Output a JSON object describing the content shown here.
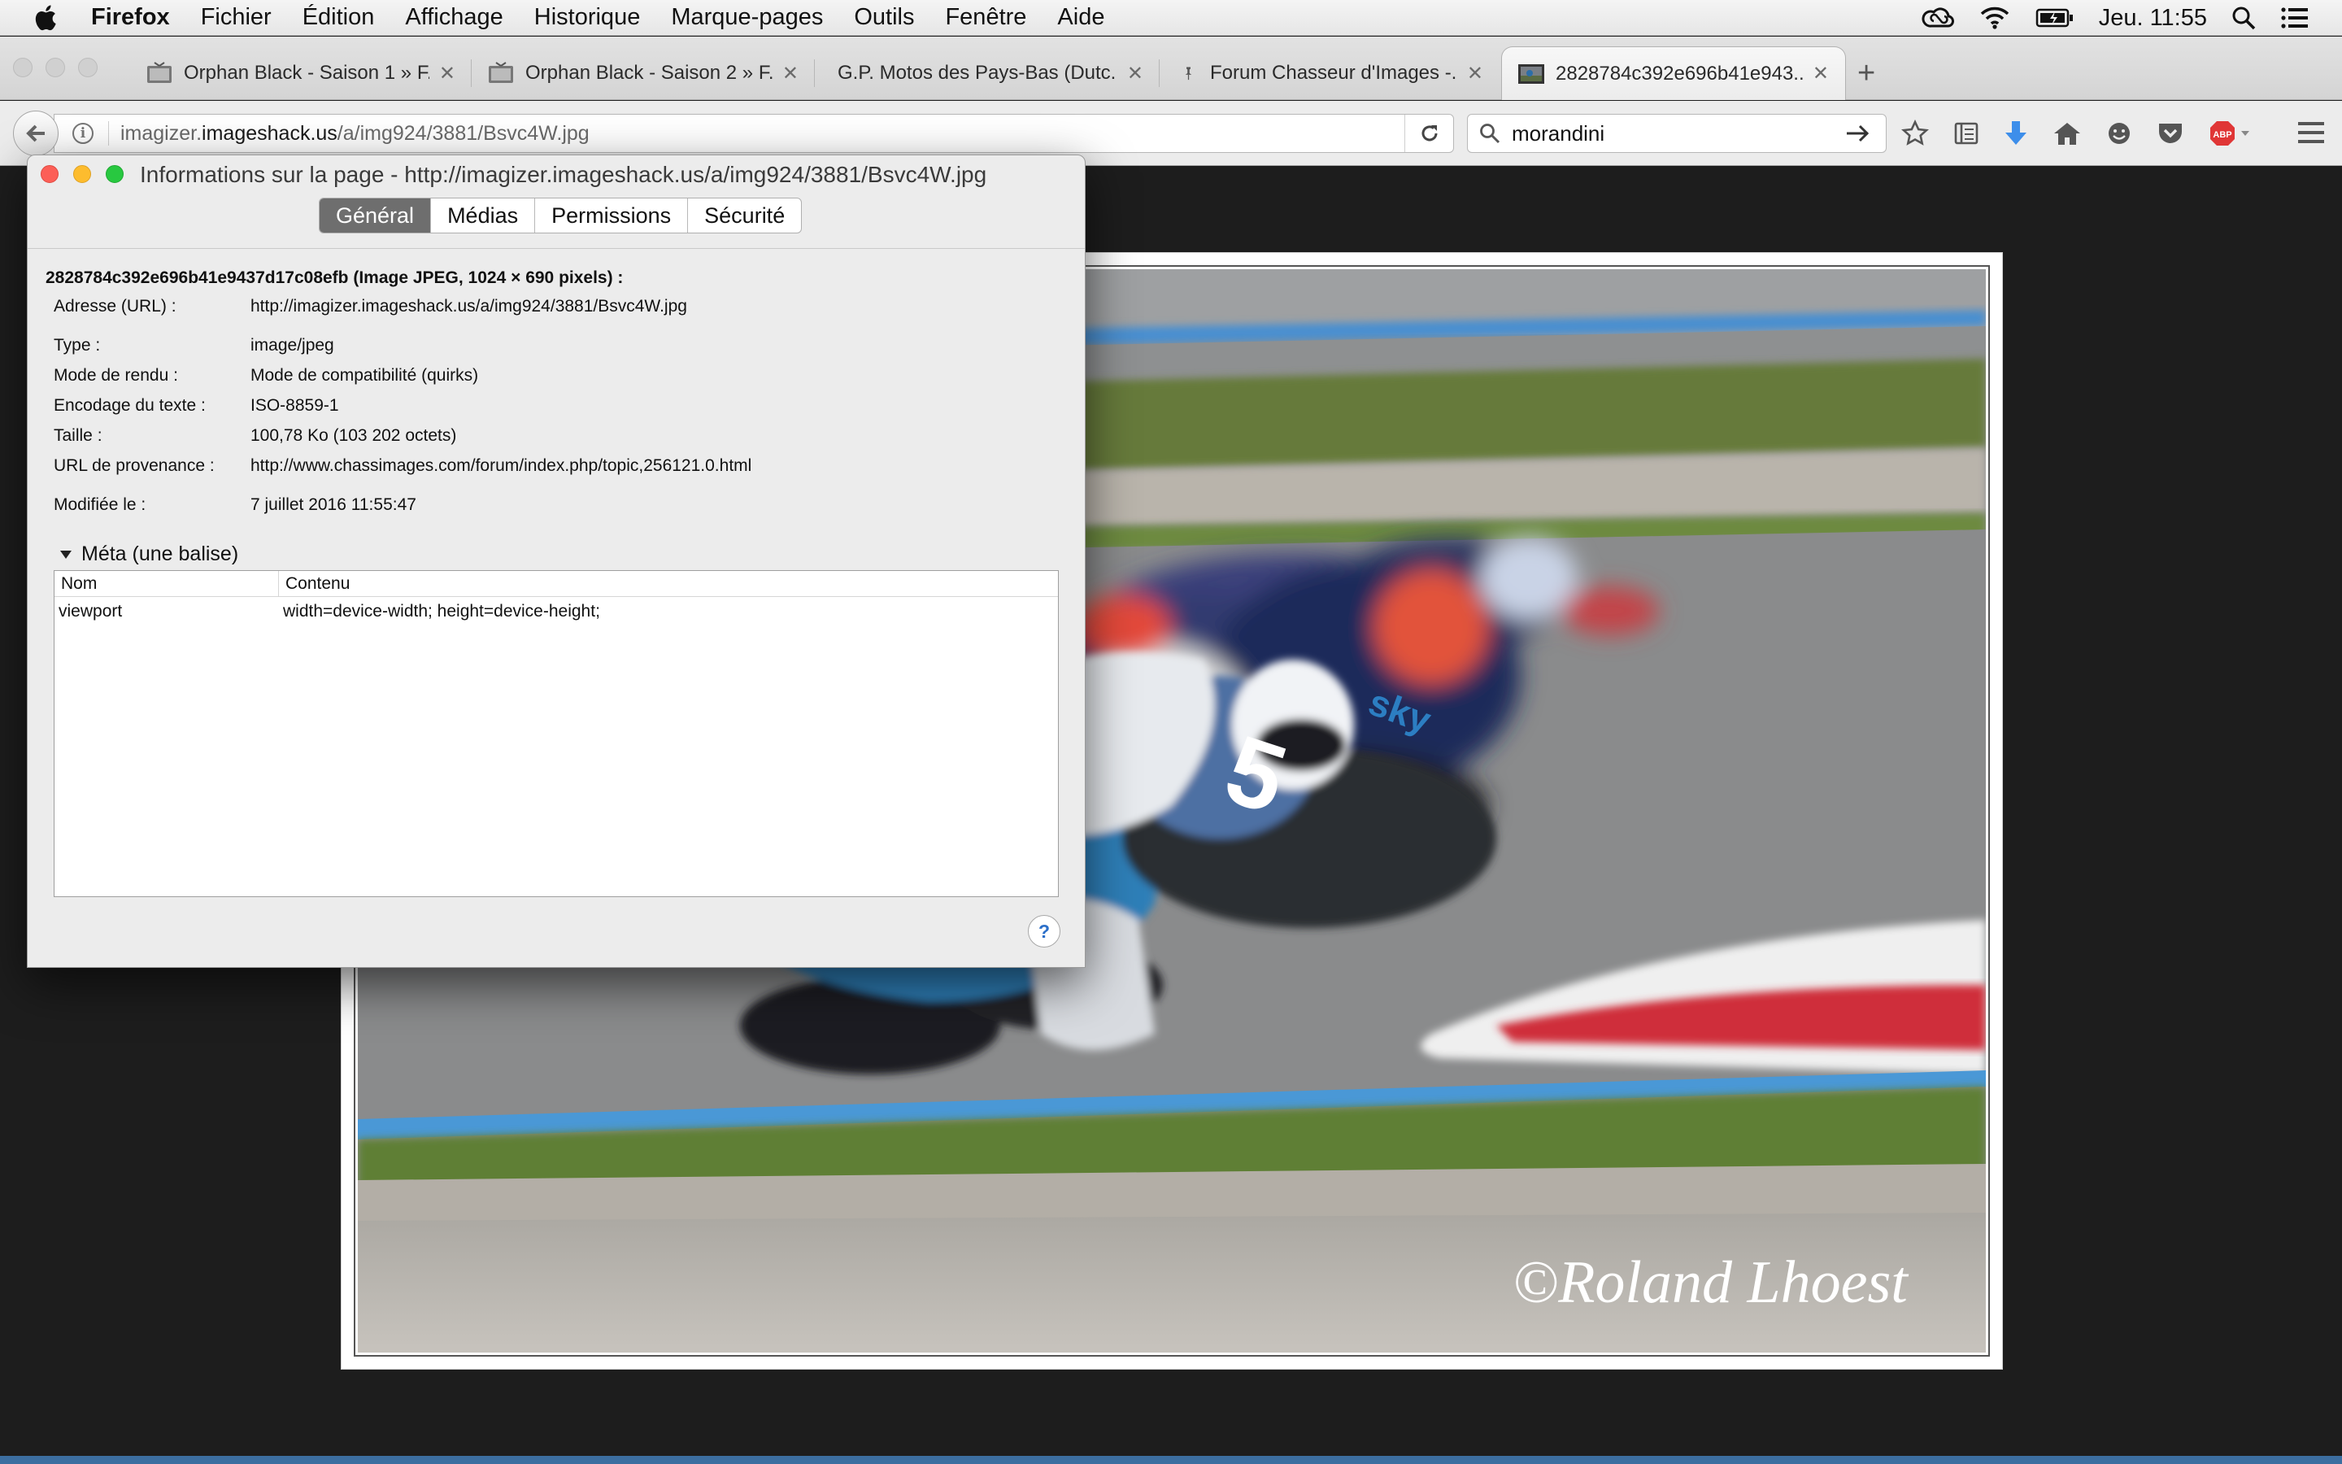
{
  "menubar": {
    "items": [
      "Firefox",
      "Fichier",
      "Édition",
      "Affichage",
      "Historique",
      "Marque-pages",
      "Outils",
      "Fenêtre",
      "Aide"
    ],
    "clock": "Jeu. 11:55"
  },
  "tabs": [
    {
      "label": "Orphan Black - Saison 1 » F...",
      "icon": "tv-icon"
    },
    {
      "label": "Orphan Black - Saison 2 » F...",
      "icon": "tv-icon"
    },
    {
      "label": "G.P. Motos des Pays-Bas (Dutc...",
      "icon": ""
    },
    {
      "label": "Forum Chasseur d'Images -...",
      "icon": "pin-icon"
    },
    {
      "label": "2828784c392e696b41e943...",
      "icon": "image-thumb-icon"
    }
  ],
  "nav": {
    "url_prefix": "imagizer.",
    "url_domain": "imageshack.us",
    "url_path": "/a/img924/3881/Bsvc4W.jpg",
    "search_value": "morandini",
    "adblock_label": "ABP"
  },
  "dialog": {
    "title": "Informations sur la page - http://imagizer.imageshack.us/a/img924/3881/Bsvc4W.jpg",
    "tabs": [
      "Général",
      "Médias",
      "Permissions",
      "Sécurité"
    ],
    "active_tab": "Général",
    "file_heading": "2828784c392e696b41e9437d17c08efb (Image JPEG, 1024 × 690 pixels) :",
    "rows": [
      {
        "key": "Adresse (URL) :",
        "value": "http://imagizer.imageshack.us/a/img924/3881/Bsvc4W.jpg"
      },
      {
        "key": "Type :",
        "value": "image/jpeg"
      },
      {
        "key": "Mode de rendu :",
        "value": "Mode de compatibilité (quirks)"
      },
      {
        "key": "Encodage du texte :",
        "value": "ISO-8859-1"
      },
      {
        "key": "Taille :",
        "value": "100,78 Ko (103 202 octets)"
      },
      {
        "key": "URL de provenance :",
        "value": "http://www.chassimages.com/forum/index.php/topic,256121.0.html"
      },
      {
        "key": "Modifiée le :",
        "value": "7 juillet 2016 11:55:47"
      }
    ],
    "meta_label": "Méta (une balise)",
    "meta_columns": [
      "Nom",
      "Contenu"
    ],
    "meta_rows": [
      {
        "name": "viewport",
        "content": "width=device-width; height=device-height;"
      }
    ],
    "help_label": "?"
  },
  "photo": {
    "watermark": "©Roland Lhoest",
    "rider_number": "5",
    "sponsor": "sky"
  },
  "colors": {
    "close": "#fc5f57",
    "minimize": "#fdbc2e",
    "zoom": "#28c840",
    "active_segment": "#6e6e6e"
  }
}
